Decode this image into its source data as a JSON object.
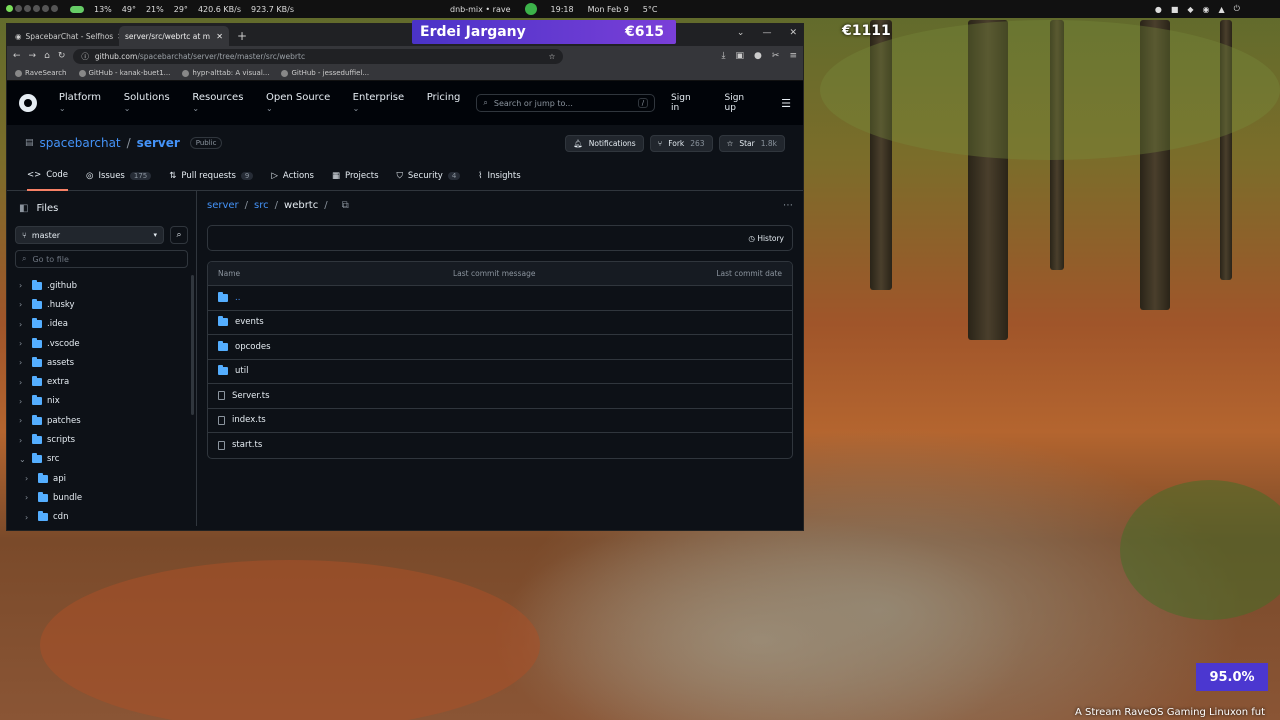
{
  "topbar": {
    "stats": [
      "13%",
      "49°",
      "21%",
      "29°",
      "420.6 KB/s",
      "923.7 KB/s"
    ],
    "media": "dnb-mix • rave",
    "time": "19:18",
    "date": "Mon Feb 9",
    "temp": "5°C"
  },
  "overlay": {
    "banner_name": "Erdei Jargany",
    "banner_amount": "€615",
    "amount2": "€1111",
    "percent": "95.0%",
    "stream_text": "A Stream RaveOS Gaming Linuxon fut"
  },
  "browser": {
    "tabs": [
      {
        "label": "SpacebarChat - Selfhos"
      },
      {
        "label": "server/src/webrtc at m"
      }
    ],
    "url_host": "github.com",
    "url_path": "/spacebarchat/server/tree/master/src/webrtc",
    "bookmarks": [
      "RaveSearch",
      "GitHub - kanak-buet1...",
      "hypr-alttab: A visual...",
      "GitHub - jesseduffiel..."
    ]
  },
  "github": {
    "nav": [
      "Platform",
      "Solutions",
      "Resources",
      "Open Source",
      "Enterprise",
      "Pricing"
    ],
    "search_placeholder": "Search or jump to...",
    "search_key": "/",
    "sign_in": "Sign in",
    "sign_up": "Sign up"
  },
  "repo": {
    "owner": "spacebarchat",
    "sep": "/",
    "name": "server",
    "visibility": "Public",
    "notifications": "Notifications",
    "fork_label": "Fork",
    "fork_count": "263",
    "star_label": "Star",
    "star_count": "1.8k",
    "tabs": [
      {
        "label": "Code",
        "count": ""
      },
      {
        "label": "Issues",
        "count": "175"
      },
      {
        "label": "Pull requests",
        "count": "9"
      },
      {
        "label": "Actions",
        "count": ""
      },
      {
        "label": "Projects",
        "count": ""
      },
      {
        "label": "Security",
        "count": "4"
      },
      {
        "label": "Insights",
        "count": ""
      }
    ]
  },
  "sidebar": {
    "title": "Files",
    "branch": "master",
    "goto_placeholder": "Go to file",
    "tree": [
      {
        "label": ".github",
        "indent": 0,
        "open": false
      },
      {
        "label": ".husky",
        "indent": 0,
        "open": false
      },
      {
        "label": ".idea",
        "indent": 0,
        "open": false
      },
      {
        "label": ".vscode",
        "indent": 0,
        "open": false
      },
      {
        "label": "assets",
        "indent": 0,
        "open": false
      },
      {
        "label": "extra",
        "indent": 0,
        "open": false
      },
      {
        "label": "nix",
        "indent": 0,
        "open": false
      },
      {
        "label": "patches",
        "indent": 0,
        "open": false
      },
      {
        "label": "scripts",
        "indent": 0,
        "open": false
      },
      {
        "label": "src",
        "indent": 0,
        "open": true
      },
      {
        "label": "api",
        "indent": 1,
        "open": false
      },
      {
        "label": "bundle",
        "indent": 1,
        "open": false
      },
      {
        "label": "cdn",
        "indent": 1,
        "open": false
      }
    ]
  },
  "content": {
    "crumbs": [
      "server",
      "src",
      "webrtc"
    ],
    "crumb_sep": "/",
    "history": "History",
    "columns": [
      "Name",
      "Last commit message",
      "Last commit date"
    ],
    "files": [
      {
        "name": "..",
        "type": "folder"
      },
      {
        "name": "events",
        "type": "folder"
      },
      {
        "name": "opcodes",
        "type": "folder"
      },
      {
        "name": "util",
        "type": "folder"
      },
      {
        "name": "Server.ts",
        "type": "file"
      },
      {
        "name": "index.ts",
        "type": "file"
      },
      {
        "name": "start.ts",
        "type": "file"
      }
    ]
  }
}
